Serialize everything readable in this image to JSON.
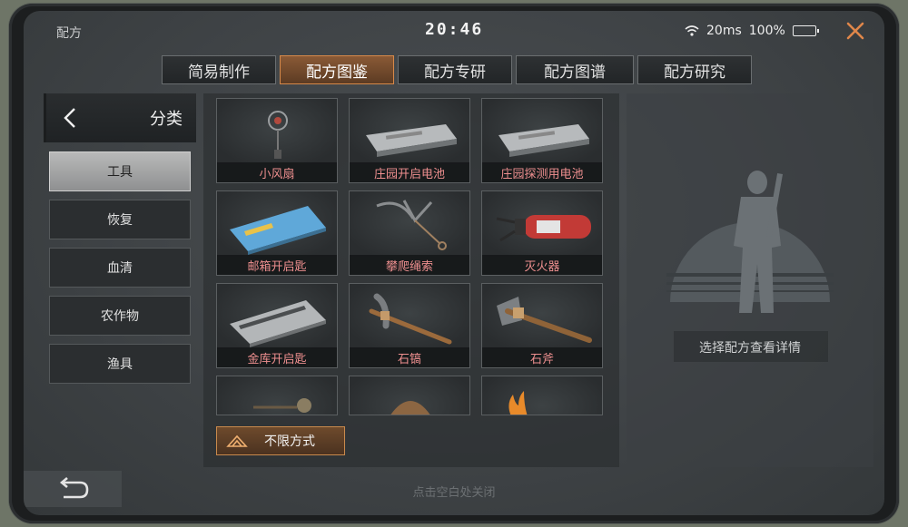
{
  "status": {
    "title": "配方",
    "time": "20:46",
    "ping": "20ms",
    "battery": "100%"
  },
  "tabs": [
    {
      "label": "简易制作"
    },
    {
      "label": "配方图鉴"
    },
    {
      "label": "配方专研"
    },
    {
      "label": "配方图谱"
    },
    {
      "label": "配方研究"
    }
  ],
  "sidebar": {
    "title": "分类",
    "items": [
      {
        "label": "工具"
      },
      {
        "label": "恢复"
      },
      {
        "label": "血清"
      },
      {
        "label": "农作物"
      },
      {
        "label": "渔具"
      }
    ]
  },
  "grid": {
    "items": [
      {
        "label": "小风扇",
        "icon": "fan-icon"
      },
      {
        "label": "庄园开启电池",
        "icon": "battery-icon"
      },
      {
        "label": "庄园探测用电池",
        "icon": "battery-icon"
      },
      {
        "label": "邮箱开启匙",
        "icon": "keycard-icon"
      },
      {
        "label": "攀爬绳索",
        "icon": "grappling-hook-icon"
      },
      {
        "label": "灭火器",
        "icon": "extinguisher-icon"
      },
      {
        "label": "金库开启匙",
        "icon": "keycard-icon"
      },
      {
        "label": "石镐",
        "icon": "stone-pickaxe-icon"
      },
      {
        "label": "石斧",
        "icon": "stone-axe-icon"
      }
    ],
    "filter_label": "不限方式"
  },
  "detail": {
    "hint": "选择配方查看详情"
  },
  "footer": {
    "hint": "点击空白处关闭"
  },
  "colors": {
    "accent": "#d6894a",
    "item_label": "#ee8f8f"
  }
}
